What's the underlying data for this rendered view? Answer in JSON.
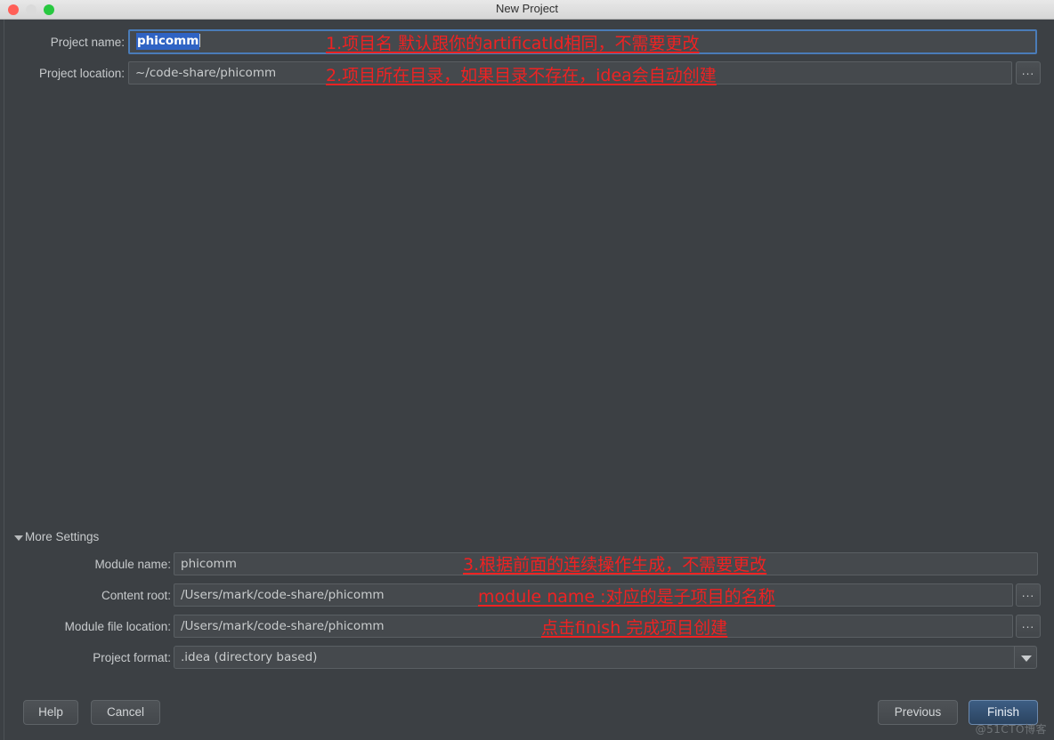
{
  "window": {
    "title": "New Project",
    "traffic_lights": [
      "close-red",
      "minimize-gray",
      "zoom-green"
    ]
  },
  "top_form": {
    "project_name": {
      "label": "Project name:",
      "value": "phicomm",
      "selected": true
    },
    "project_location": {
      "label": "Project location:",
      "value": "~/code-share/phicomm",
      "browse_label": "..."
    }
  },
  "annotations": {
    "a1": "1.项目名 默认跟你的artificatId相同，不需要更改",
    "a2": "2.项目所在目录，如果目录不存在，idea会自动创建",
    "a3": "3.根据前面的连续操作生成，不需要更改",
    "a4": "module name :对应的是子项目的名称",
    "a5": "点击finish 完成项目创建"
  },
  "more_settings": {
    "label": "More Settings",
    "expanded": true,
    "fields": [
      {
        "label": "Module name:",
        "value": "phicomm",
        "browse": false,
        "dropdown": false
      },
      {
        "label": "Content root:",
        "value": "/Users/mark/code-share/phicomm",
        "browse": true,
        "dropdown": false,
        "browse_label": "..."
      },
      {
        "label": "Module file location:",
        "value": "/Users/mark/code-share/phicomm",
        "browse": true,
        "dropdown": false,
        "browse_label": "..."
      },
      {
        "label": "Project format:",
        "value": ".idea (directory based)",
        "browse": false,
        "dropdown": true
      }
    ]
  },
  "footer": {
    "help": "Help",
    "cancel": "Cancel",
    "previous": "Previous",
    "finish": "Finish"
  },
  "watermark": "@51CTO博客",
  "colors": {
    "dialog_bg": "#3c4044",
    "field_bg": "#45494d",
    "annotation_red": "#ef2222",
    "focus_blue": "#4a7cb8",
    "selection_blue": "#2f63c4",
    "primary_button_blue": "#3d5e84"
  }
}
